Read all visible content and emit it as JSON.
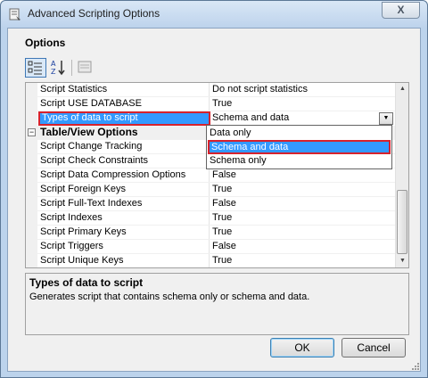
{
  "window": {
    "title": "Advanced Scripting Options",
    "close_label": "X"
  },
  "options_label": "Options",
  "grid": {
    "rows": [
      {
        "name": "Script Statistics",
        "value": "Do not script statistics"
      },
      {
        "name": "Script USE DATABASE",
        "value": "True"
      },
      {
        "name": "Types of data to script",
        "value": "Schema and data"
      },
      {
        "name": "Table/View Options",
        "value": "",
        "category": true
      },
      {
        "name": "Script Change Tracking",
        "value": ""
      },
      {
        "name": "Script Check Constraints",
        "value": ""
      },
      {
        "name": "Script Data Compression Options",
        "value": "False"
      },
      {
        "name": "Script Foreign Keys",
        "value": "True"
      },
      {
        "name": "Script Full-Text Indexes",
        "value": "False"
      },
      {
        "name": "Script Indexes",
        "value": "True"
      },
      {
        "name": "Script Primary Keys",
        "value": "True"
      },
      {
        "name": "Script Triggers",
        "value": "False"
      },
      {
        "name": "Script Unique Keys",
        "value": "True"
      }
    ],
    "category_toggle": "−",
    "dropdown_options": [
      "Data only",
      "Schema and data",
      "Schema only"
    ],
    "selected_option": "Schema and data",
    "scroll_up": "▲",
    "scroll_down": "▼",
    "dropdown_arrow": "▼"
  },
  "help": {
    "title": "Types of data to script",
    "description": "Generates script that contains schema only or schema and data."
  },
  "buttons": {
    "ok": "OK",
    "cancel": "Cancel"
  },
  "colors": {
    "selection": "#3399ff",
    "highlight_border": "#d7222c",
    "title_bar": "#bdd3ec"
  }
}
